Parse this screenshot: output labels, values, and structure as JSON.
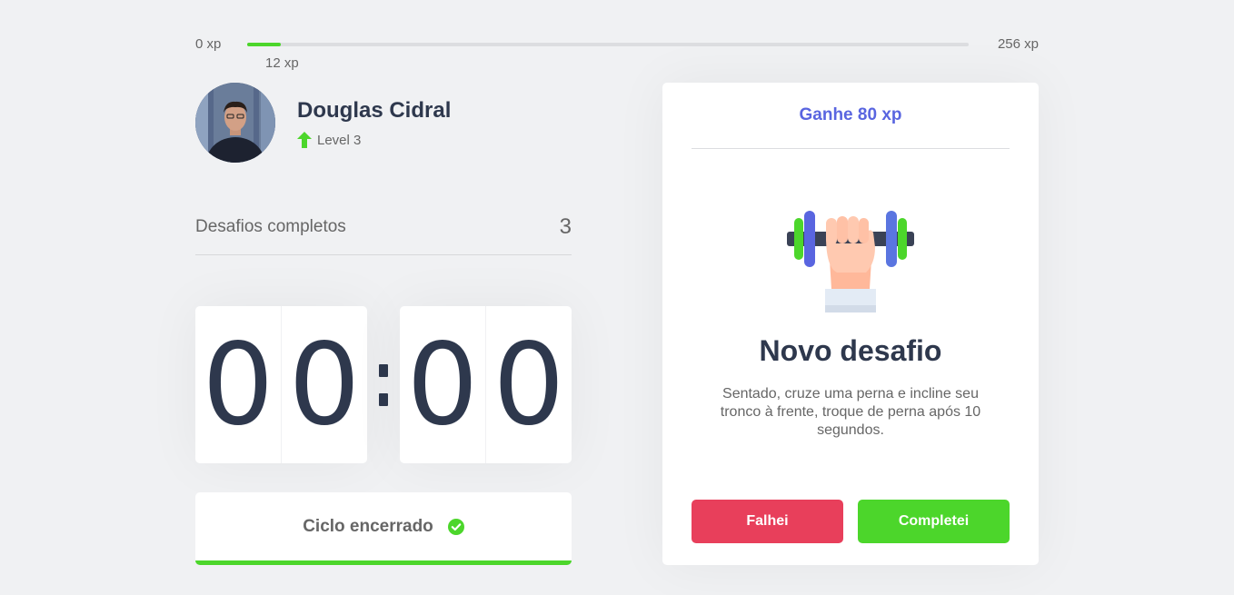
{
  "xp": {
    "min_label": "0 xp",
    "max_label": "256 xp",
    "current_label": "12 xp",
    "current": 12,
    "max": 256,
    "fill_color": "#4cd62b"
  },
  "profile": {
    "name": "Douglas Cidral",
    "level_label": "Level 3",
    "level_icon": "level-up-arrow-icon"
  },
  "completed_challenges": {
    "label": "Desafios completos",
    "count": "3"
  },
  "countdown": {
    "minute_left": "0",
    "minute_right": "0",
    "second_left": "0",
    "second_right": "0"
  },
  "cycle_button": {
    "label": "Ciclo encerrado",
    "icon": "check-circle-icon"
  },
  "challenge": {
    "reward_label": "Ganhe 80 xp",
    "icon": "dumbbell-icon",
    "title": "Novo desafio",
    "description": "Sentado, cruze uma perna e incline seu tronco à frente, troque de perna após 10 segundos.",
    "fail_label": "Falhei",
    "success_label": "Completei"
  },
  "colors": {
    "accent_blue": "#5965e0",
    "green": "#4cd62b",
    "red": "#e83f5b",
    "title": "#2e384d",
    "text": "#666666",
    "background": "#f0f1f3"
  }
}
